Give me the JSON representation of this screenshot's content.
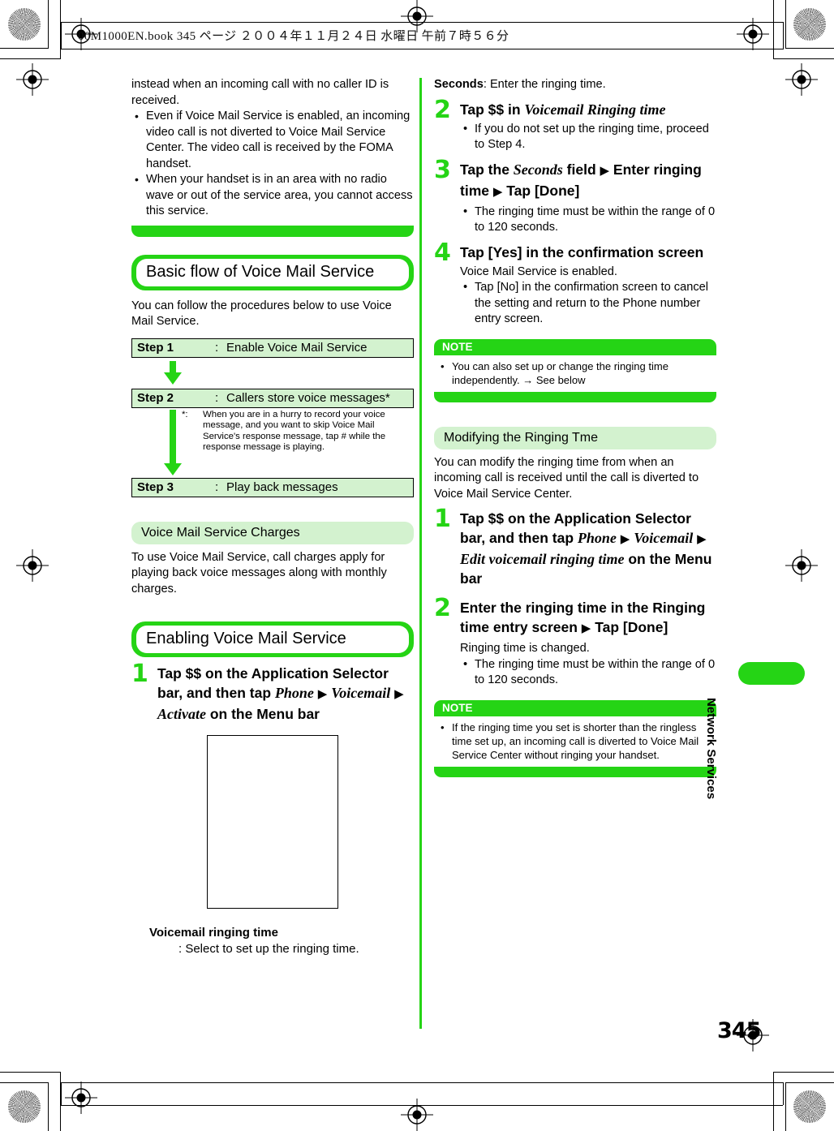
{
  "header": {
    "book_line": "00M1000EN.book   345 ページ  ２００４年１１月２４日  水曜日  午前７時５６分"
  },
  "page_number": "345",
  "side_tab_label": "Network Services",
  "left_column": {
    "continued_note": {
      "lead_text": "instead when an incoming call with no caller ID is received.",
      "bullets": [
        "Even if Voice Mail Service is enabled, an incoming video call is not diverted to Voice Mail Service Center. The video call is received by the FOMA handset.",
        "When your handset is in an area with no radio wave or out of the service area, you cannot access this service."
      ]
    },
    "section_basic_flow": {
      "title": "Basic flow of Voice Mail Service",
      "intro": "You can follow the procedures below to use Voice Mail Service.",
      "steps": [
        {
          "label": "Step 1",
          "colon": ":",
          "value": "Enable Voice Mail Service"
        },
        {
          "label": "Step 2",
          "colon": ":",
          "value": "Callers store voice messages*"
        },
        {
          "label": "Step 3",
          "colon": ":",
          "value": "Play back messages"
        }
      ],
      "footnote_marker": "*:",
      "footnote_text": "When you are in a hurry to record your voice message, and you want to skip Voice Mail Service's response message, tap # while the response message is playing."
    },
    "section_charges": {
      "title": "Voice Mail Service Charges",
      "body": "To use Voice Mail Service, call charges apply for playing back voice messages along with monthly charges."
    },
    "section_enabling": {
      "title": "Enabling Voice Mail Service",
      "step1": {
        "number": "1",
        "title_parts": [
          {
            "t": "Tap $$ on the Application Selector bar, and then tap ",
            "style": "bold"
          },
          {
            "t": "Phone",
            "style": "italic"
          },
          {
            "t": " ▶ ",
            "style": "bold"
          },
          {
            "t": "Voicemail",
            "style": "italic"
          },
          {
            "t": " ▶ ",
            "style": "bold"
          },
          {
            "t": "Activate",
            "style": "italic"
          },
          {
            "t": " on the Menu bar",
            "style": "bold"
          }
        ]
      },
      "screenshot_alt": "Voicemail setup screen",
      "caption_title": "Voicemail ringing time",
      "caption_sub": ":  Select to set up the ringing time."
    }
  },
  "right_column": {
    "seconds_line_label": "Seconds",
    "seconds_line_colon": ":",
    "seconds_line_value": "Enter the ringing time.",
    "steps": [
      {
        "number": "2",
        "title_parts": [
          {
            "t": "Tap $$ in ",
            "style": "bold"
          },
          {
            "t": "Voicemail Ringing time",
            "style": "italic"
          }
        ],
        "bullets": [
          "If you do not set up the ringing time, proceed to Step 4."
        ],
        "lead": ""
      },
      {
        "number": "3",
        "title_parts": [
          {
            "t": "Tap the ",
            "style": "bold"
          },
          {
            "t": "Seconds",
            "style": "italic"
          },
          {
            "t": " field ▶ Enter ringing time ▶ Tap [Done]",
            "style": "bold"
          }
        ],
        "bullets": [
          "The ringing time must be within the range of 0 to 120 seconds."
        ],
        "lead": ""
      },
      {
        "number": "4",
        "title_parts": [
          {
            "t": "Tap [Yes] in the confirmation screen",
            "style": "bold"
          }
        ],
        "lead": "Voice Mail Service is enabled.",
        "bullets": [
          "Tap [No] in the confirmation screen to cancel the setting and return to the Phone number entry screen."
        ]
      }
    ],
    "note1": {
      "head": "NOTE",
      "bullets": [
        "You can also set up or change the ringing time independently. → See below"
      ]
    },
    "section_modifying": {
      "title": "Modifying the Ringing Tme",
      "body": "You can modify the ringing time from when an incoming call is received until the call is diverted to Voice Mail Service Center.",
      "steps": [
        {
          "number": "1",
          "title_parts": [
            {
              "t": "Tap $$ on the Application Selector bar, and then tap ",
              "style": "bold"
            },
            {
              "t": "Phone",
              "style": "italic"
            },
            {
              "t": " ▶ ",
              "style": "bold"
            },
            {
              "t": "Voicemail",
              "style": "italic"
            },
            {
              "t": " ▶ ",
              "style": "bold"
            },
            {
              "t": "Edit voicemail ringing time",
              "style": "italic"
            },
            {
              "t": " on the Menu bar",
              "style": "bold"
            }
          ],
          "lead": "",
          "bullets": []
        },
        {
          "number": "2",
          "title_parts": [
            {
              "t": "Enter the ringing time in the Ringing time entry screen ▶ Tap [Done]",
              "style": "bold"
            }
          ],
          "lead": "Ringing time is changed.",
          "bullets": [
            "The ringing time must be within the range of 0 to 120 seconds."
          ]
        }
      ]
    },
    "note2": {
      "head": "NOTE",
      "bullets": [
        "If the ringing time you set is shorter than the ringless time set up, an incoming call is diverted to Voice Mail Service Center without ringing your handset."
      ]
    }
  },
  "colors": {
    "brand_green": "#25d415",
    "light_green": "#d3f2cf",
    "text": "#000000"
  }
}
